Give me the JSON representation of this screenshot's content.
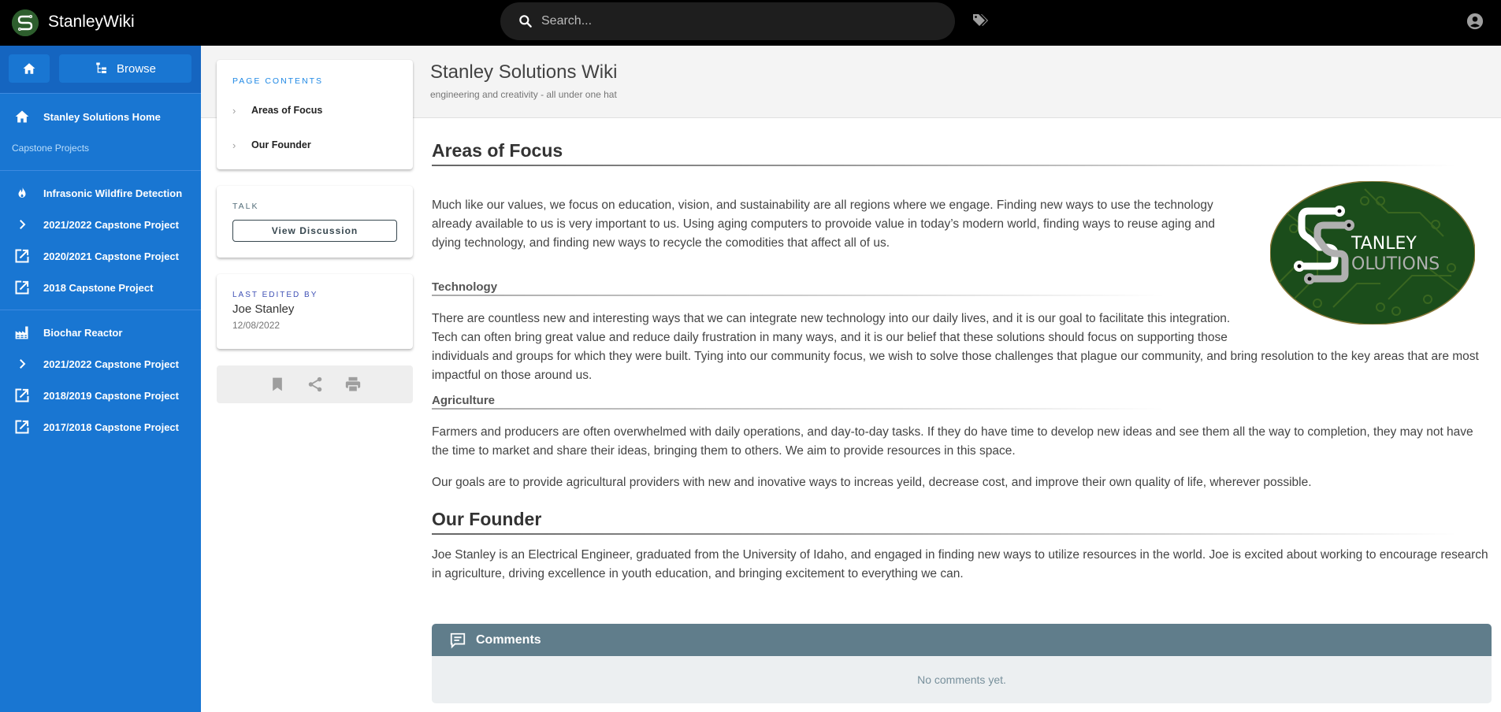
{
  "header": {
    "app_title": "StanleyWiki",
    "search_placeholder": "Search...",
    "search_value": "",
    "icons": {
      "logo": "stanley-s-logo",
      "search": "search-icon",
      "tags": "tags-icon",
      "account": "account-circle-icon"
    }
  },
  "sidebar": {
    "browse_label": "Browse",
    "home_item": {
      "label": "Stanley Solutions Home",
      "icon": "home-icon"
    },
    "section_header": "Capstone Projects",
    "group1": [
      {
        "label": "Infrasonic Wildfire Detection",
        "icon": "fire-icon"
      },
      {
        "label": "2021/2022 Capstone Project",
        "icon": "chevron-right-icon"
      },
      {
        "label": "2020/2021 Capstone Project",
        "icon": "open-in-new-icon"
      },
      {
        "label": "2018 Capstone Project",
        "icon": "open-in-new-icon"
      }
    ],
    "group2": [
      {
        "label": "Biochar Reactor",
        "icon": "factory-icon"
      },
      {
        "label": "2021/2022 Capstone Project",
        "icon": "chevron-right-icon"
      },
      {
        "label": "2018/2019 Capstone Project",
        "icon": "open-in-new-icon"
      },
      {
        "label": "2017/2018 Capstone Project",
        "icon": "open-in-new-icon"
      }
    ],
    "colors": {
      "background": "#1976d2",
      "top_bar": "#1565c0"
    }
  },
  "page": {
    "title": "Stanley Solutions Wiki",
    "subtitle": "engineering and creativity - all under one hat"
  },
  "toc": {
    "label": "Page Contents",
    "items": [
      "Areas of Focus",
      "Our Founder"
    ]
  },
  "talk": {
    "label": "Talk",
    "button": "View Discussion"
  },
  "last_edited": {
    "label": "Last Edited By",
    "name": "Joe Stanley",
    "date": "12/08/2022"
  },
  "actions": [
    "bookmark-icon",
    "share-icon",
    "print-icon"
  ],
  "content": {
    "areas_heading": "Areas of Focus",
    "areas_para": "Much like our values, we focus on education, vision, and sustainability are all regions where we engage. Finding new ways to use the technology already available to us is very important to us. Using aging computers to provoide value in today’s modern world, finding ways to reuse aging and dying technology, and finding new ways to recycle the comodities that affect all of us.",
    "logo_text": [
      "TANLEY",
      "OLUTIONS"
    ],
    "tech_heading": "Technology",
    "tech_para": "There are countless new and interesting ways that we can integrate new technology into our daily lives, and it is our goal to facilitate this integration. Tech can often bring great value and reduce daily frustration in many ways, and it is our belief that these solutions should focus on supporting those individuals and groups for which they were built. Tying into our community focus, we wish to solve those challenges that plague our community, and bring resolution to the key areas that are most impactful on those around us.",
    "agri_heading": "Agriculture",
    "agri_para1": "Farmers and producers are often overwhelmed with daily operations, and day-to-day tasks. If they do have time to develop new ideas and see them all the way to completion, they may not have the time to market and share their ideas, bringing them to others. We aim to provide resources in this space.",
    "agri_para2": "Our goals are to provide agricultural providers with new and inovative ways to increas yeild, decrease cost, and improve their own quality of life, wherever possible.",
    "founder_heading": "Our Founder",
    "founder_para": "Joe Stanley is an Electrical Engineer, graduated from the University of Idaho, and engaged in finding new ways to utilize resources in the world. Joe is excited about working to encourage research in agriculture, driving excellence in youth education, and bringing excitement to everything we can."
  },
  "comments": {
    "title": "Comments",
    "empty_text": "No comments yet.",
    "header_color": "#607d8b"
  }
}
